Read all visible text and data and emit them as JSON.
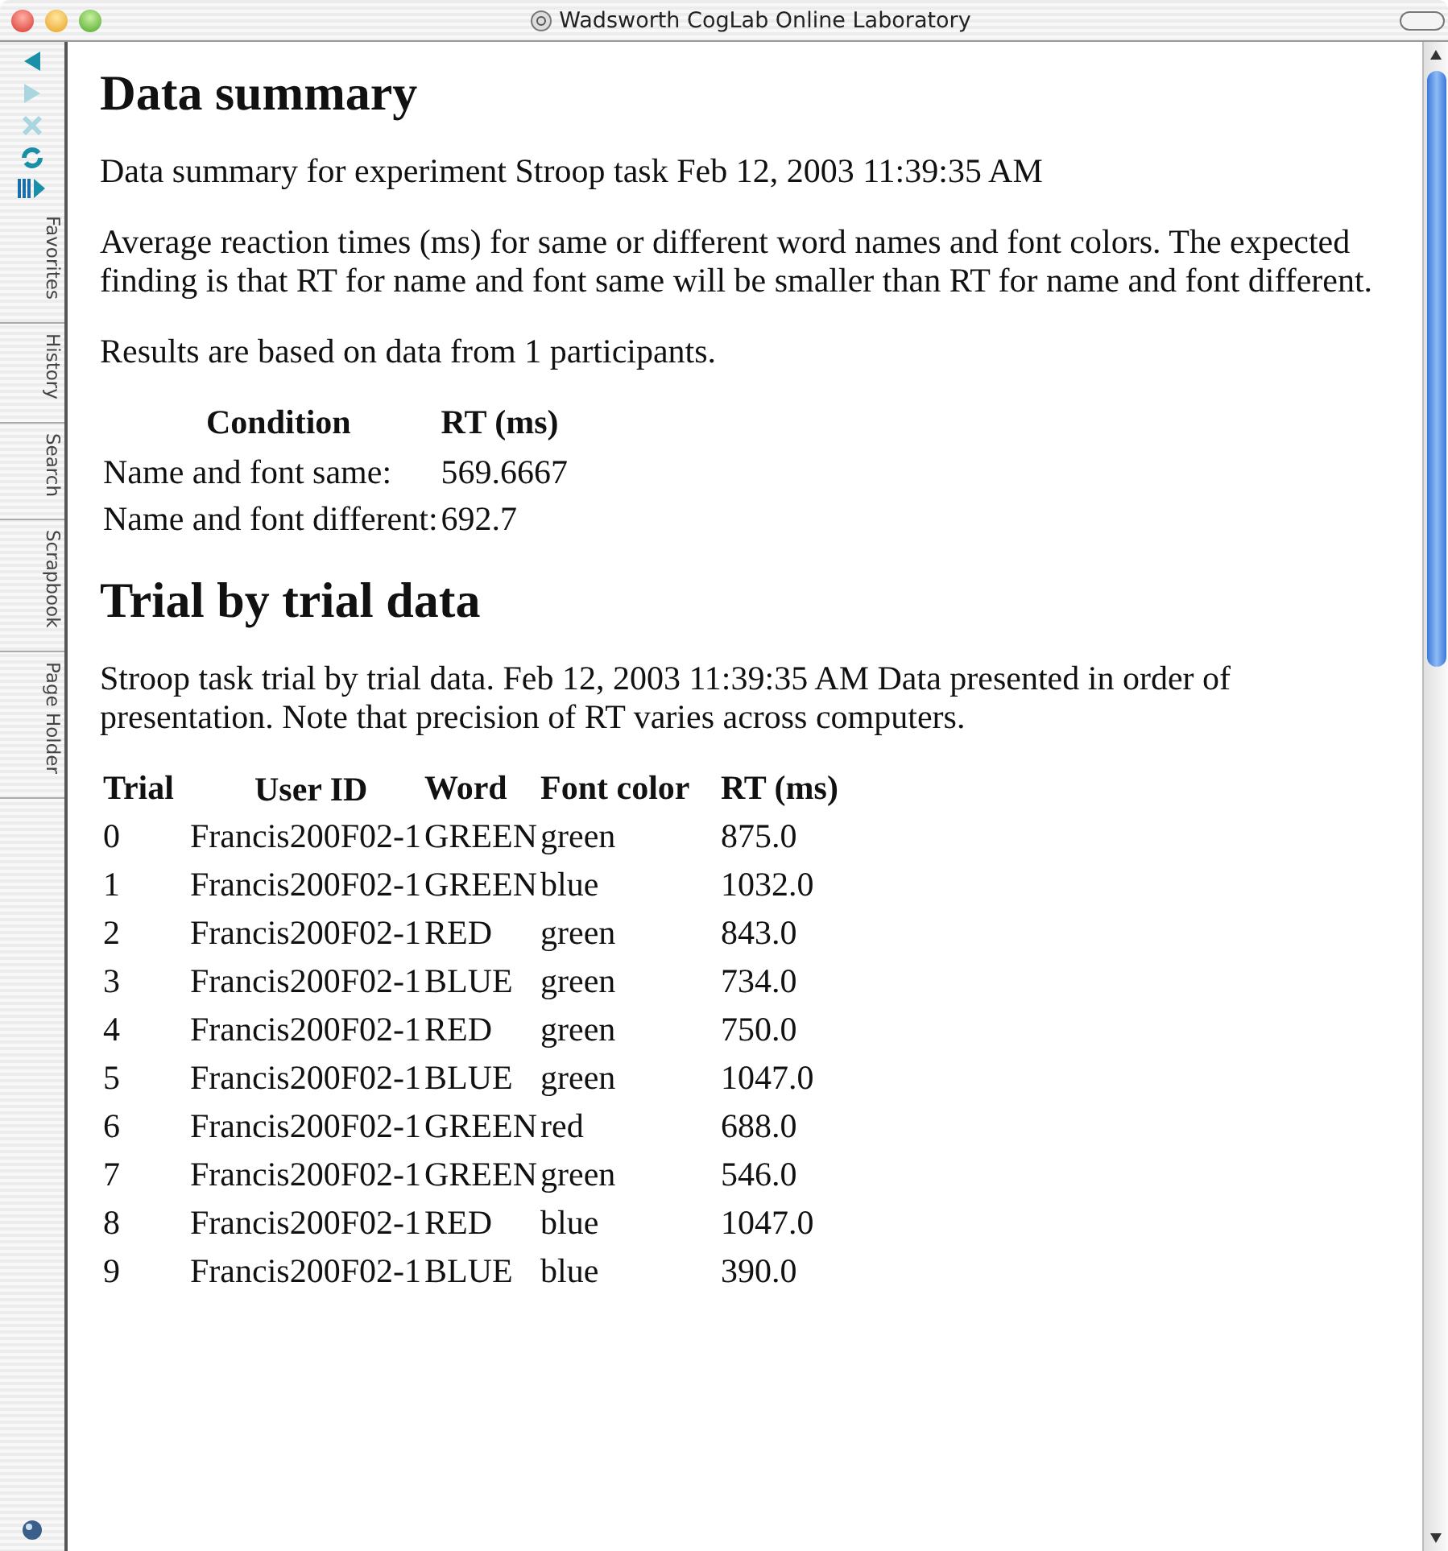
{
  "window": {
    "title": "Wadsworth CogLab Online Laboratory"
  },
  "sidebar": {
    "tabs": [
      "Favorites",
      "History",
      "Search",
      "Scrapbook",
      "Page Holder"
    ]
  },
  "summary": {
    "heading": "Data summary",
    "experiment": "Data summary for experiment Stroop task Feb 12, 2003 11:39:35 AM",
    "description": "Average reaction times (ms) for same or different word names and font colors. The expected finding is that RT for name and font same will be smaller than RT for name and font different.",
    "participants": "Results are based on data from 1 participants.",
    "table": {
      "columns": [
        "Condition",
        "RT (ms)"
      ],
      "rows": [
        [
          "Name and font same:",
          "569.6667"
        ],
        [
          "Name and font different:",
          "692.7"
        ]
      ]
    }
  },
  "trials": {
    "heading": "Trial by trial data",
    "description": "Stroop task trial by trial data. Feb 12, 2003 11:39:35 AM Data presented in order of presentation. Note that precision of RT varies across computers.",
    "table": {
      "columns": [
        "Trial",
        "User ID",
        "Word",
        "Font color",
        "RT (ms)"
      ],
      "rows": [
        [
          "0",
          "Francis200F02-1",
          "GREEN",
          "green",
          "875.0"
        ],
        [
          "1",
          "Francis200F02-1",
          "GREEN",
          "blue",
          "1032.0"
        ],
        [
          "2",
          "Francis200F02-1",
          "RED",
          "green",
          "843.0"
        ],
        [
          "3",
          "Francis200F02-1",
          "BLUE",
          "green",
          "734.0"
        ],
        [
          "4",
          "Francis200F02-1",
          "RED",
          "green",
          "750.0"
        ],
        [
          "5",
          "Francis200F02-1",
          "BLUE",
          "green",
          "1047.0"
        ],
        [
          "6",
          "Francis200F02-1",
          "GREEN",
          "red",
          "688.0"
        ],
        [
          "7",
          "Francis200F02-1",
          "GREEN",
          "green",
          "546.0"
        ],
        [
          "8",
          "Francis200F02-1",
          "RED",
          "blue",
          "1047.0"
        ],
        [
          "9",
          "Francis200F02-1",
          "BLUE",
          "blue",
          "390.0"
        ]
      ]
    }
  }
}
